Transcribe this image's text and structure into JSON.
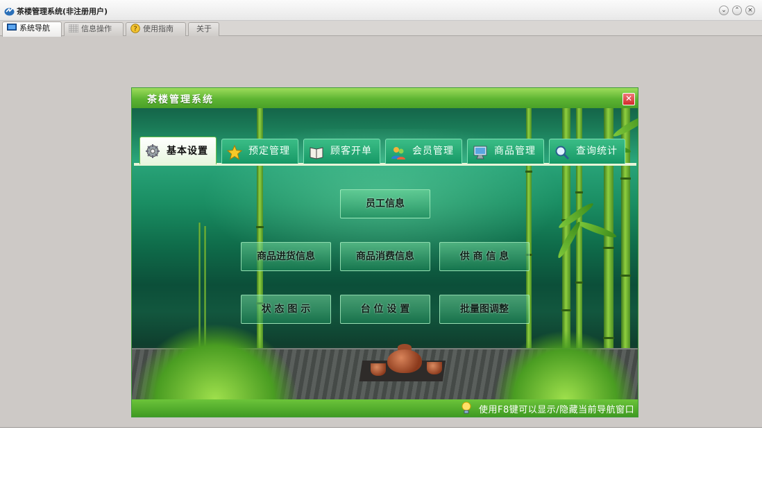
{
  "app": {
    "title": "茶楼管理系统(非注册用户)",
    "tabs": [
      {
        "label": "系统导航",
        "icon": "monitor-icon",
        "active": true
      },
      {
        "label": "信息操作",
        "icon": "grid-icon",
        "active": false
      },
      {
        "label": "使用指南",
        "icon": "help-icon",
        "active": false
      },
      {
        "label": "关于",
        "icon": "",
        "active": false
      }
    ]
  },
  "nav_window": {
    "title": "茶楼管理系统",
    "close_icon": "close-icon",
    "modules": [
      {
        "label": "基本设置",
        "icon": "gear-icon",
        "active": true
      },
      {
        "label": "预定管理",
        "icon": "star-icon",
        "active": false
      },
      {
        "label": "顾客开单",
        "icon": "book-icon",
        "active": false
      },
      {
        "label": "会员管理",
        "icon": "users-icon",
        "active": false
      },
      {
        "label": "商品管理",
        "icon": "monitor-icon",
        "active": false
      },
      {
        "label": "查询统计",
        "icon": "magnifier-icon",
        "active": false
      }
    ],
    "buttons": {
      "employee_info": "员工信息",
      "goods_purchase": "商品进货信息",
      "goods_consume": "商品消费信息",
      "supplier_info": "供 商 信 息",
      "status_legend": "状 态 图 示",
      "table_settings": "台 位 设 置",
      "batch_adjust": "批量图调整"
    },
    "status_tip": "使用F8键可以显示/隐藏当前导航窗口"
  },
  "colors": {
    "accent_green": "#5db432",
    "tab_teal": "#169866",
    "close_red": "#d12a2a"
  }
}
